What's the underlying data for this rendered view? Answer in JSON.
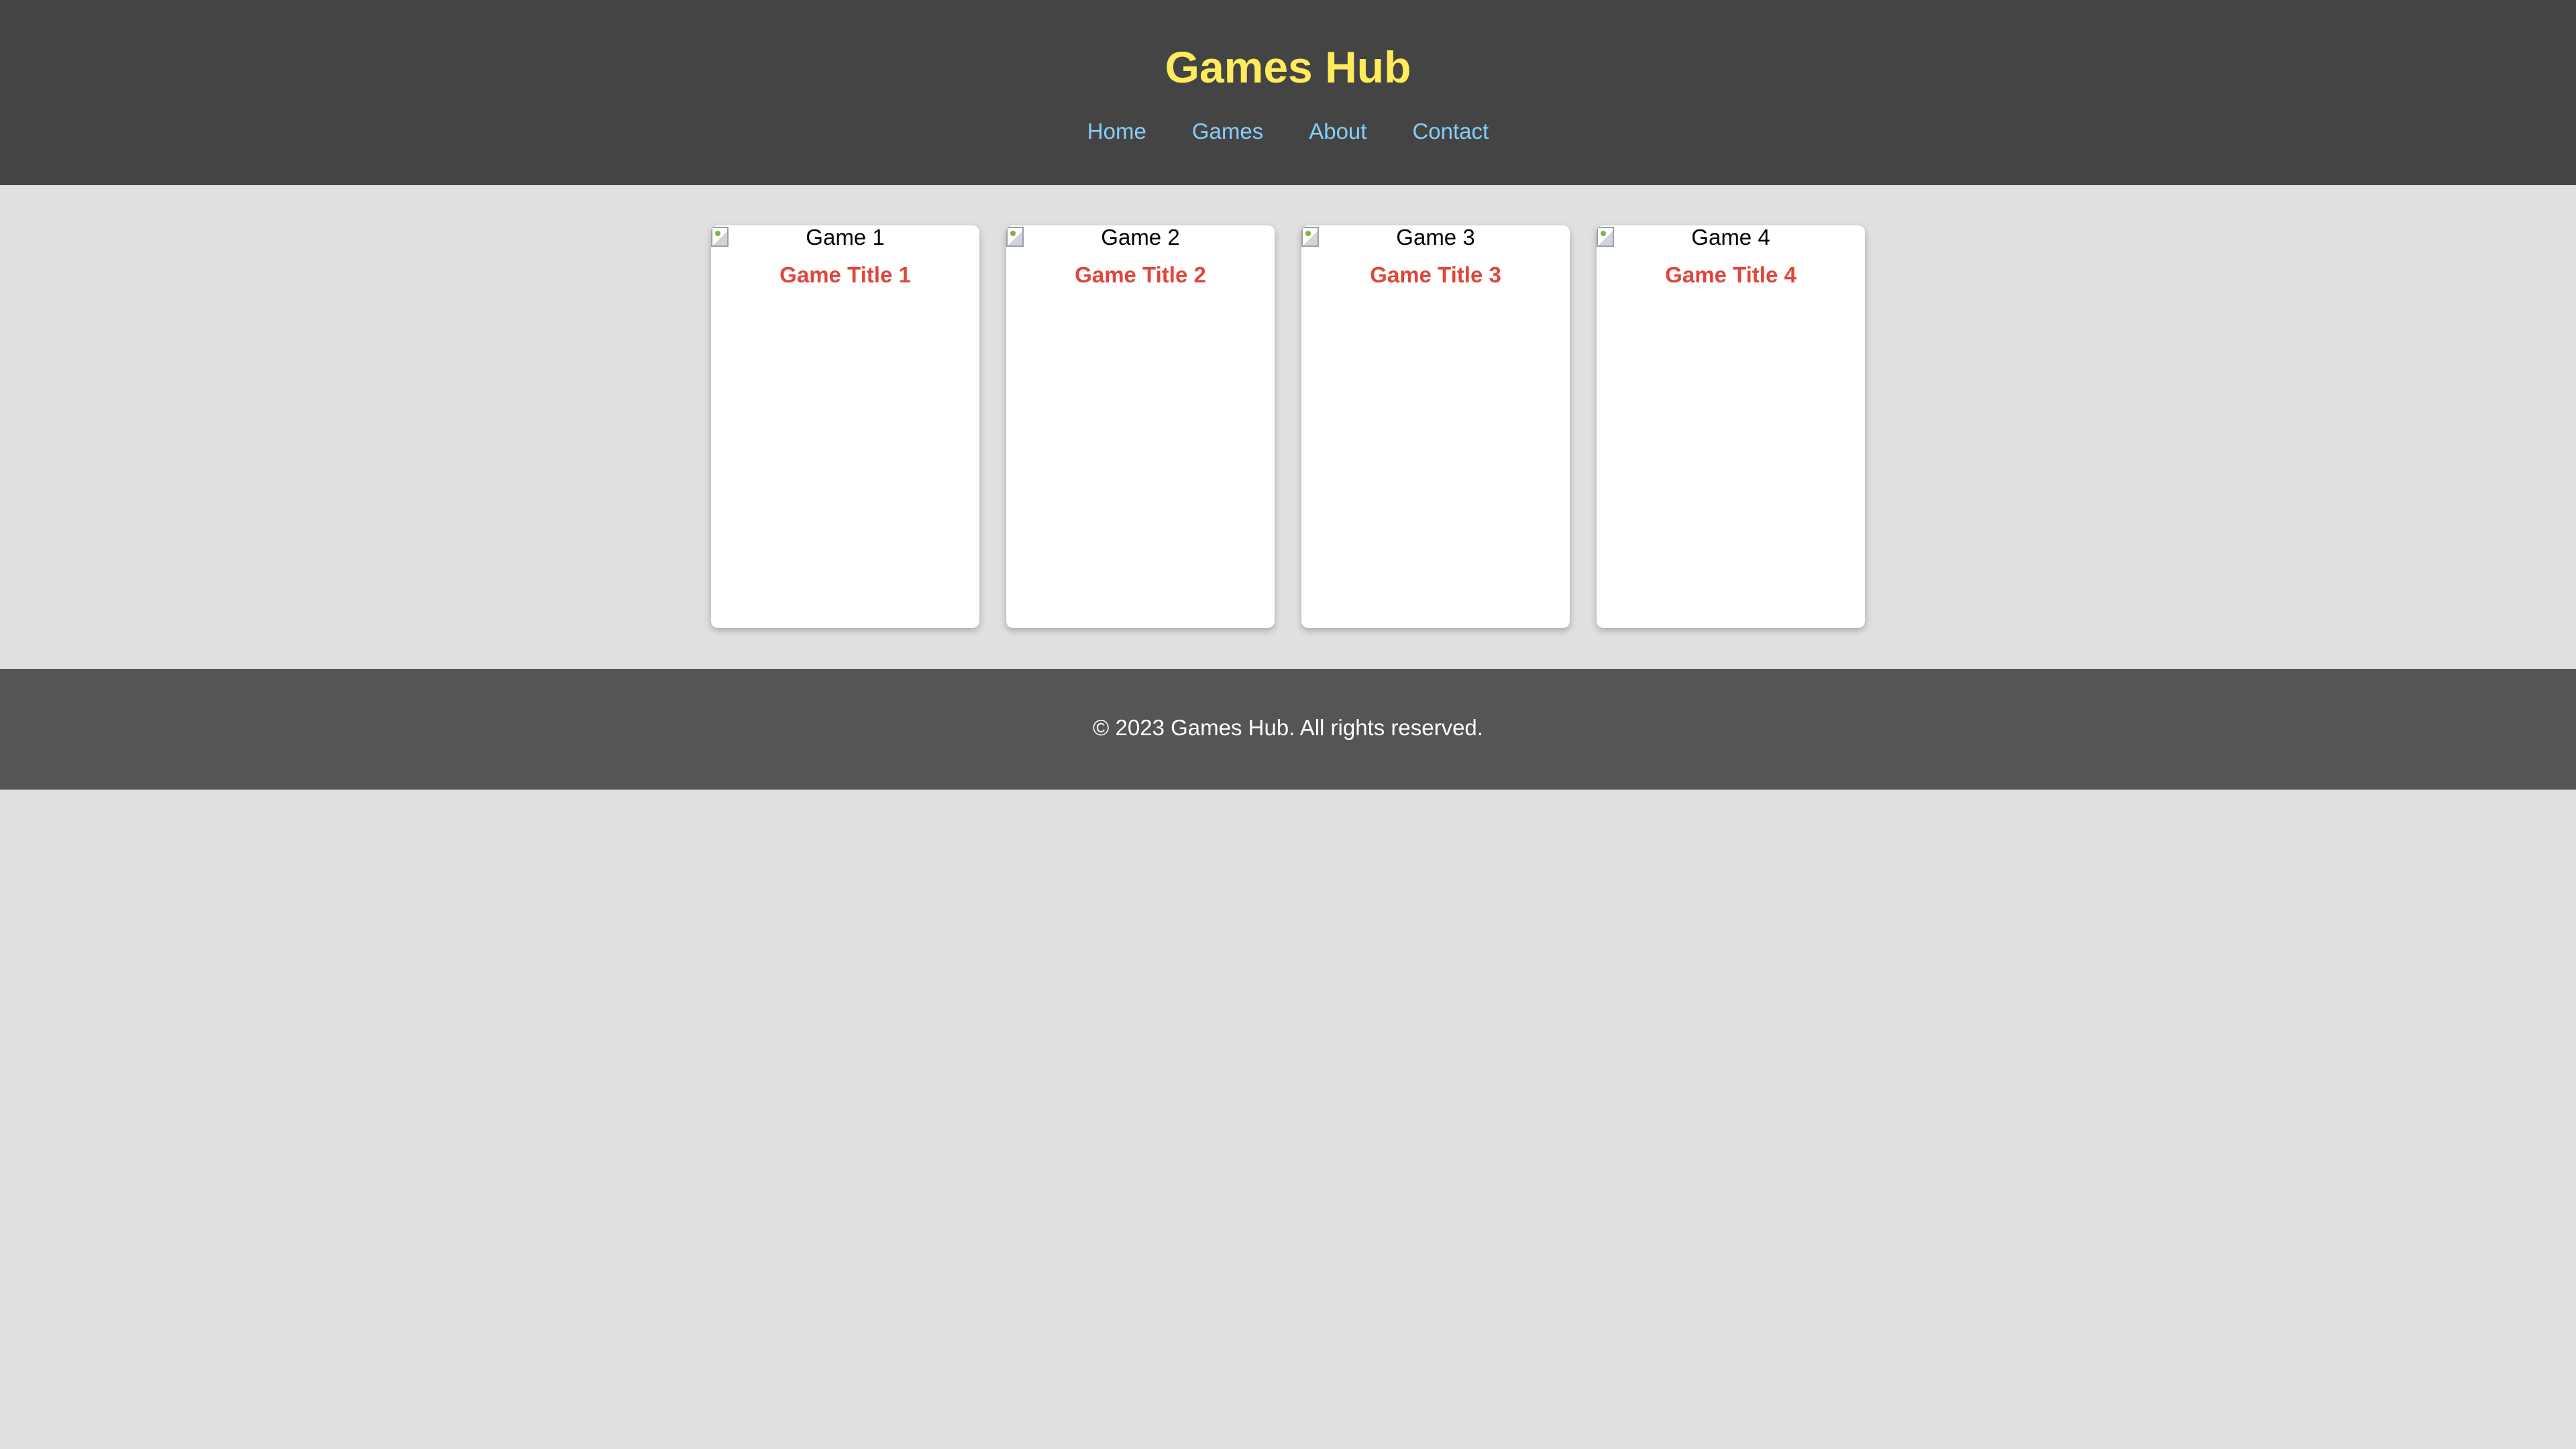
{
  "header": {
    "title": "Games Hub",
    "nav": [
      "Home",
      "Games",
      "About",
      "Contact"
    ]
  },
  "cards": [
    {
      "image_alt": "Game 1",
      "title": "Game Title 1"
    },
    {
      "image_alt": "Game 2",
      "title": "Game Title 2"
    },
    {
      "image_alt": "Game 3",
      "title": "Game Title 3"
    },
    {
      "image_alt": "Game 4",
      "title": "Game Title 4"
    }
  ],
  "footer": {
    "text": "© 2023 Games Hub. All rights reserved."
  },
  "colors": {
    "header_bg": "#444444",
    "title": "#ffeb5b",
    "nav_link": "#87cefa",
    "page_bg": "#e0e0e0",
    "card_title": "#e0463c",
    "footer_bg": "#555555"
  }
}
